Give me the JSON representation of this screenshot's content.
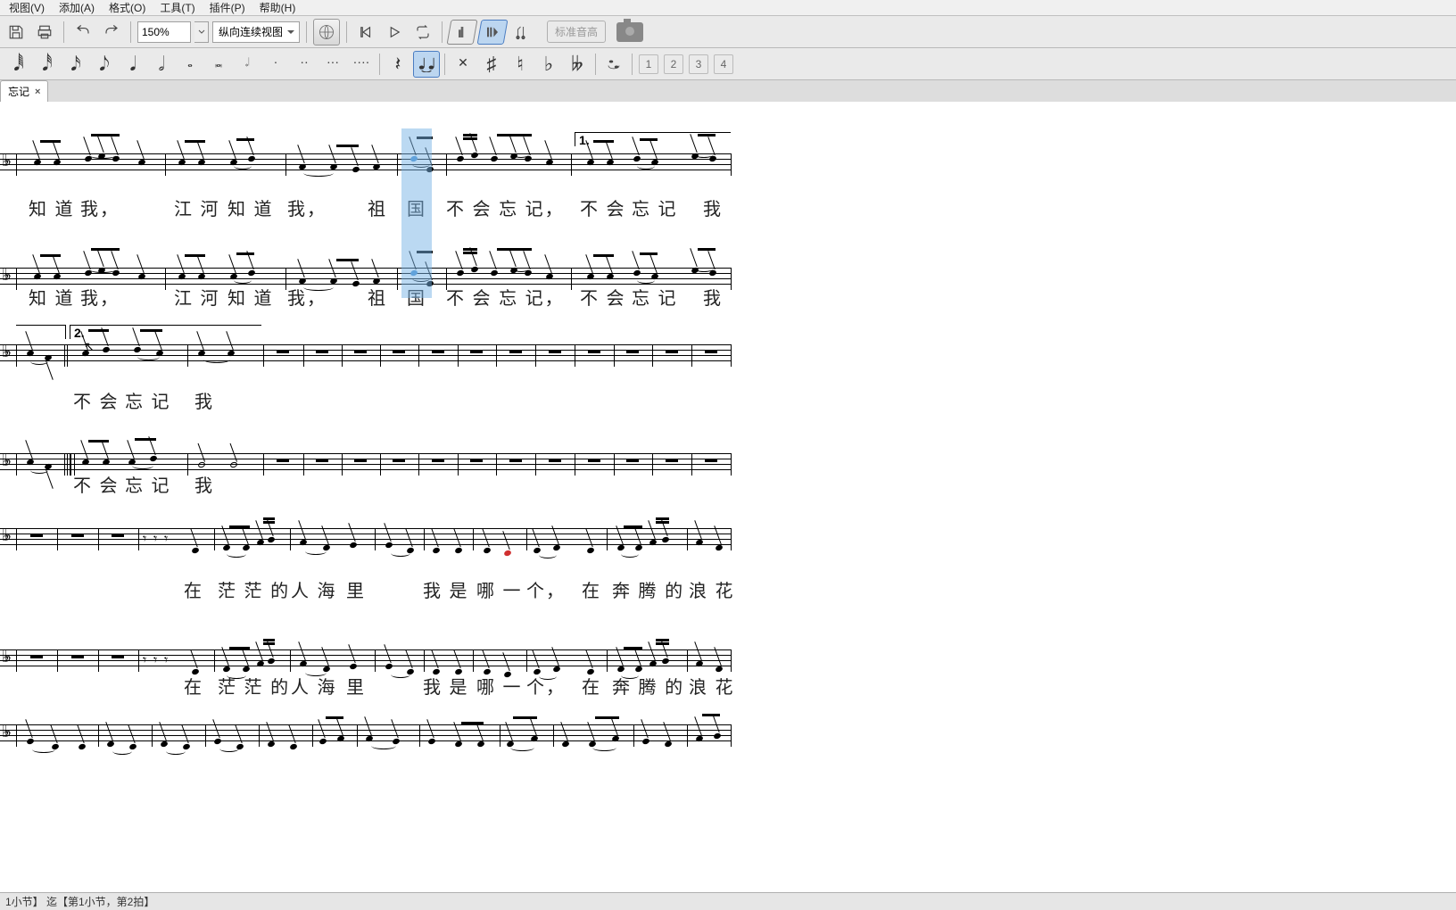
{
  "menu": {
    "view": "视图(V)",
    "add": "添加(A)",
    "format": "格式(O)",
    "tools": "工具(T)",
    "plugins": "插件(P)",
    "help": "帮助(H)"
  },
  "toolbar": {
    "zoom": "150%",
    "view_mode": "纵向连续视图",
    "concert_pitch": "标准音高"
  },
  "note_toolbar": {
    "voices": [
      "1",
      "2",
      "3",
      "4"
    ]
  },
  "tab": {
    "title": "忘记",
    "close": "×"
  },
  "score": {
    "volta_1": "1.",
    "volta_2": "2.",
    "sys1": {
      "lyrics_a": [
        "知 道",
        "我，",
        "江 河",
        "知 道",
        "我，",
        "祖",
        "国",
        "不 会 忘 记，",
        "不 会",
        "忘 记",
        "我"
      ],
      "lyrics_b": [
        "知 道",
        "我，",
        "江 河",
        "知 道",
        "我，",
        "祖",
        "国",
        "不 会 忘 记，",
        "不 会",
        "忘 记",
        "我"
      ]
    },
    "sys2": {
      "lyrics_a": [
        "不 会",
        "忘 记",
        "我"
      ],
      "lyrics_b": [
        "不 会",
        "忘 记",
        "我"
      ]
    },
    "sys3": {
      "lyrics_a": [
        "在",
        "茫 茫 的",
        "人 海",
        "里",
        "我 是",
        "哪 一",
        "个，",
        "在",
        "奔 腾 的",
        "浪 花"
      ],
      "lyrics_b": [
        "在",
        "茫 茫 的",
        "人 海",
        "里",
        "我 是",
        "哪 一",
        "个，",
        "在",
        "奔 腾 的",
        "浪 花"
      ]
    }
  },
  "status": {
    "text": "1小节】 迄【第1小节，第2拍】"
  }
}
